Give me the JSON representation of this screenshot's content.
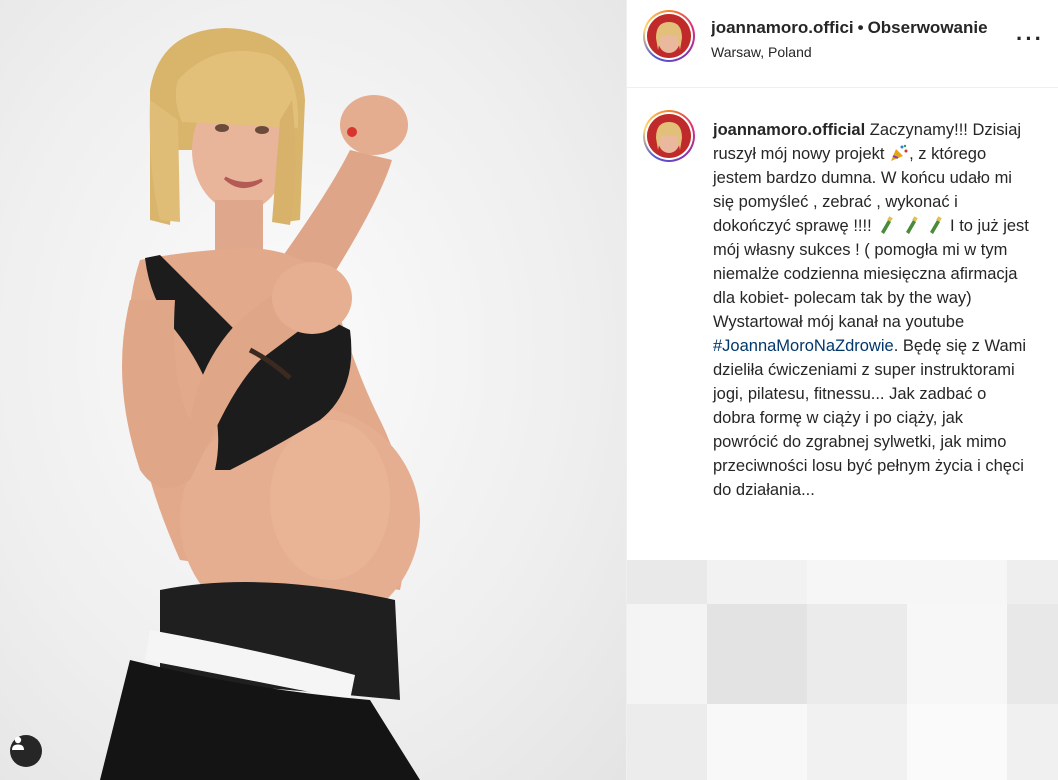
{
  "post": {
    "photo": {
      "description_icon": "person-tag-icon"
    }
  },
  "header": {
    "username": "joannamoro.offici",
    "separator": "•",
    "follow_label": "Obserwowanie",
    "location": "Warsaw, Poland",
    "more_icon": "more-horizontal-icon",
    "more_label": "···"
  },
  "caption": {
    "username": "joannamoro.official",
    "text_part1": "Zaczynamy!!! Dzisiaj ruszył mój nowy projekt",
    "text_part2": ", z którego jestem bardzo dumna. W końcu udało mi się pomyśleć , zebrać , wykonać i dokończyć sprawę !!!!",
    "text_part3": " I to już jest mój własny sukces ! ( pomogła mi w tym niemalże codzienna miesięczna afirmacja dla kobiet- polecam tak by the way)",
    "text_part4": "Wystartował mój kanał na youtube",
    "hashtag": "#JoannaMoroNaZdrowie",
    "text_part5": ". Będę się z Wami dzieliła ćwiczeniami z super instruktorami jogi, pilatesu, fitnessu... Jak zadbać o dobra formę w ciąży i po ciąży, jak powrócić do zgrabnej sylwetki, jak mimo przeciwności losu być pełnym życia i chęci do działania..."
  },
  "colors": {
    "text": "#262626",
    "hashtag": "#00376b",
    "border": "#efefef"
  }
}
